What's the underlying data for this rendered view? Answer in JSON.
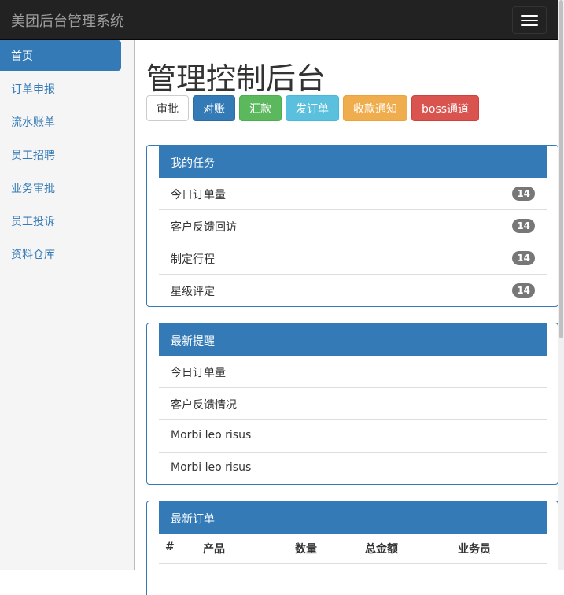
{
  "navbar": {
    "brand": "美团后台管理系统",
    "toggle_icon": "menu-icon"
  },
  "sidebar": {
    "items": [
      {
        "label": "首页",
        "active": true
      },
      {
        "label": "订单申报",
        "active": false
      },
      {
        "label": "流水账单",
        "active": false
      },
      {
        "label": "员工招聘",
        "active": false
      },
      {
        "label": "业务审批",
        "active": false
      },
      {
        "label": "员工投诉",
        "active": false
      },
      {
        "label": "资料仓库",
        "active": false
      }
    ]
  },
  "main": {
    "title": "管理控制后台",
    "buttons": [
      {
        "label": "审批",
        "style": "default"
      },
      {
        "label": "对账",
        "style": "primary"
      },
      {
        "label": "汇款",
        "style": "success"
      },
      {
        "label": "发订单",
        "style": "info"
      },
      {
        "label": "收款通知",
        "style": "warning"
      },
      {
        "label": "boss通道",
        "style": "danger"
      }
    ]
  },
  "tasks_panel": {
    "heading": "我的任务",
    "items": [
      {
        "label": "今日订单量",
        "badge": "14"
      },
      {
        "label": "客户反馈回访",
        "badge": "14"
      },
      {
        "label": "制定行程",
        "badge": "14"
      },
      {
        "label": "星级评定",
        "badge": "14"
      }
    ]
  },
  "reminders_panel": {
    "heading": "最新提醒",
    "items": [
      {
        "label": "今日订单量"
      },
      {
        "label": "客户反馈情况"
      },
      {
        "label": "Morbi leo risus"
      },
      {
        "label": "Morbi leo risus"
      }
    ]
  },
  "orders_panel": {
    "heading": "最新订单",
    "columns": [
      "#",
      "产品",
      "数量",
      "总金额",
      "业务员"
    ]
  },
  "colors": {
    "navbar_bg": "#222222",
    "primary": "#337ab7",
    "success": "#5cb85c",
    "info": "#5bc0de",
    "warning": "#f0ad4e",
    "danger": "#d9534f",
    "badge": "#777777"
  }
}
